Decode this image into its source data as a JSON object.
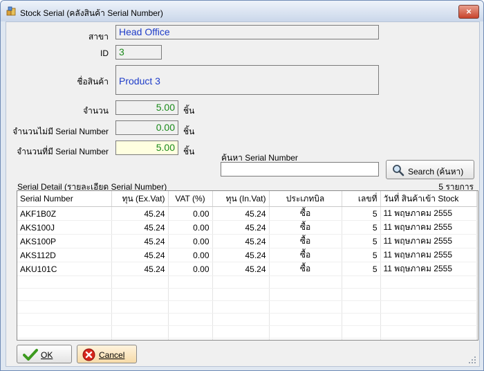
{
  "window": {
    "title": "Stock Serial (คลังสินค้า Serial Number)",
    "close_label": "×"
  },
  "form": {
    "branch_label": "สาขา",
    "branch_value": "Head Office",
    "id_label": "ID",
    "id_value": "3",
    "product_label": "ชื่อสินค้า",
    "product_value": "Product 3",
    "qty_label": "จำนวน",
    "qty_value": "5.00",
    "no_serial_label": "จำนวนไม่มี Serial Number",
    "no_serial_value": "0.00",
    "with_serial_label": "จำนวนที่มี Serial Number",
    "with_serial_value": "5.00",
    "unit": "ชิ้น"
  },
  "search": {
    "label": "ค้นหา Serial Number",
    "value": "",
    "button_label": "Search (ค้นหา)"
  },
  "grid": {
    "caption": "Serial Detail (รายละเอียด Serial Number)",
    "count": "5 รายการ",
    "columns": [
      "Serial Number",
      "ทุน (Ex.Vat)",
      "VAT (%)",
      "ทุน (In.Vat)",
      "ประเภทบิล",
      "เลขที่",
      "วันที่ สินค้าเข้า Stock"
    ],
    "rows": [
      [
        "AKF1B0Z",
        "45.24",
        "0.00",
        "45.24",
        "ซื้อ",
        "5",
        "11 พฤษภาคม 2555"
      ],
      [
        "AKS100J",
        "45.24",
        "0.00",
        "45.24",
        "ซื้อ",
        "5",
        "11 พฤษภาคม 2555"
      ],
      [
        "AKS100P",
        "45.24",
        "0.00",
        "45.24",
        "ซื้อ",
        "5",
        "11 พฤษภาคม 2555"
      ],
      [
        "AKS112D",
        "45.24",
        "0.00",
        "45.24",
        "ซื้อ",
        "5",
        "11 พฤษภาคม 2555"
      ],
      [
        "AKU101C",
        "45.24",
        "0.00",
        "45.24",
        "ซื้อ",
        "5",
        "11 พฤษภาคม 2555"
      ]
    ]
  },
  "buttons": {
    "ok_label": "OK",
    "cancel_label": "Cancel"
  },
  "colors": {
    "value_blue": "#1e3cc8",
    "value_green": "#1a8a1a",
    "highlight": "#ffffe0"
  },
  "icons": {
    "app": "stock-app-icon",
    "search": "magnifier-icon",
    "ok": "checkmark-icon",
    "cancel": "cancel-x-icon"
  }
}
